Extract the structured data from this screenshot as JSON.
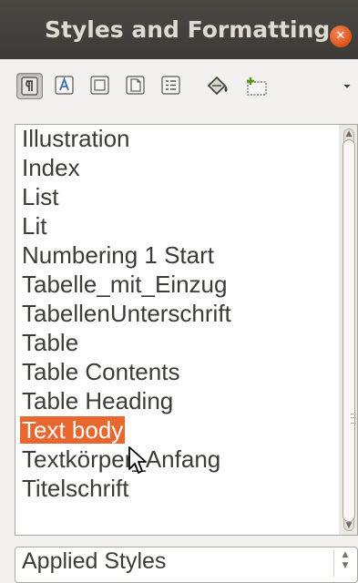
{
  "window": {
    "title": "Styles and Formatting",
    "close_icon": "close-icon"
  },
  "toolbar": {
    "buttons": [
      {
        "name": "paragraph-styles",
        "icon": "paragraph-styles-icon",
        "active": true
      },
      {
        "name": "character-styles",
        "icon": "character-styles-icon",
        "active": false
      },
      {
        "name": "frame-styles",
        "icon": "frame-styles-icon",
        "active": false
      },
      {
        "name": "page-styles",
        "icon": "page-styles-icon",
        "active": false
      },
      {
        "name": "list-styles",
        "icon": "list-styles-icon",
        "active": false
      },
      {
        "name": "fill-format-mode",
        "icon": "paint-bucket-icon",
        "active": false
      },
      {
        "name": "new-style",
        "icon": "new-style-icon",
        "active": false
      },
      {
        "name": "more",
        "icon": "chevron-down-icon",
        "active": false
      }
    ]
  },
  "styles_list": {
    "items": [
      "Illustration",
      "Index",
      "List",
      "Lit",
      "Numbering 1 Start",
      "Tabelle_mit_Einzug",
      "TabellenUnterschrift",
      "Table",
      "Table Contents",
      "Table Heading",
      "Text body",
      "Textkörper_Anfang",
      "Titelschrift"
    ],
    "selected": "Text body",
    "selected_color": "#e9672f"
  },
  "filter": {
    "value": "Applied Styles"
  },
  "colors": {
    "titlebar": "#3c3b37",
    "accent": "#e9672f",
    "text": "#3c3b37"
  }
}
